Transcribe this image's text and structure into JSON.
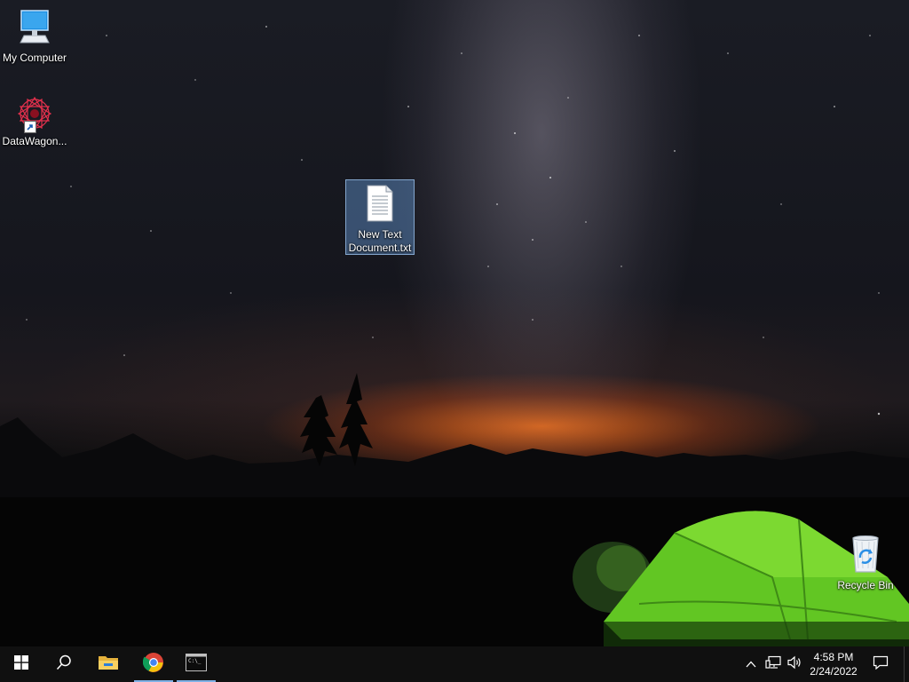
{
  "desktop": {
    "icons": [
      {
        "label": "My Computer"
      },
      {
        "label": "DataWagon..."
      },
      {
        "label_line1": "New Text",
        "label_line2": "Document.txt"
      },
      {
        "label": "Recycle Bin"
      }
    ]
  },
  "taskbar": {
    "start": "windows-start",
    "search": "search",
    "apps": [
      "File Explorer",
      "Google Chrome",
      "Command Prompt"
    ],
    "clock": {
      "time": "4:58 PM",
      "date": "2/24/2022"
    }
  },
  "colors": {
    "taskbar_bg": "#101010",
    "active_indicator": "#7fb1e6",
    "selection": "#6496d2"
  }
}
